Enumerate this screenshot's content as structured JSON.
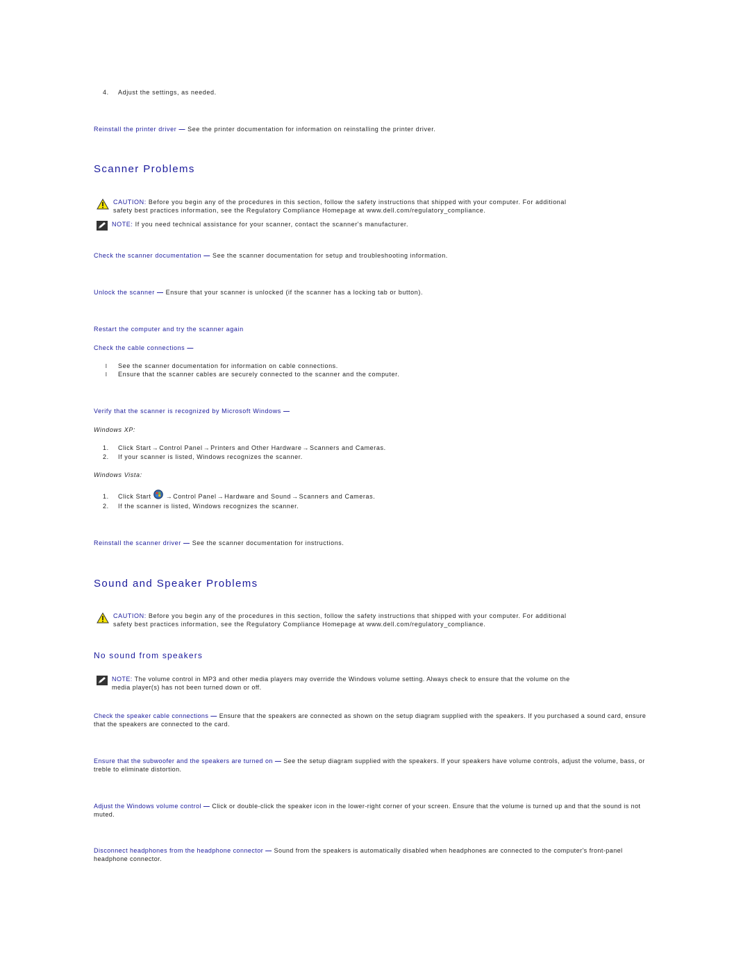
{
  "colors": {
    "link": "#1a1a9c",
    "text": "#222222",
    "caution_yellow": "#f5e400"
  },
  "top": {
    "step4_num": "4.",
    "step4_text": "Adjust the settings, as needed.",
    "reinstall_printer": {
      "link": "Reinstall the printer driver",
      "dash": "—",
      "text": "See the printer documentation for information on reinstalling the printer driver."
    }
  },
  "scanner": {
    "title": "Scanner Problems",
    "caution": {
      "icon": "warning-triangle-icon",
      "label": "CAUTION:",
      "line1": "Before you begin any of the procedures in this section, follow the safety instructions that shipped with your computer. For additional",
      "line2": "safety best practices information, see the Regulatory Compliance Homepage at www.dell.com/regulatory_compliance."
    },
    "note": {
      "icon": "note-pencil-icon",
      "label": "NOTE:",
      "text": "If you need technical assistance for your scanner, contact the scanner's manufacturer."
    },
    "check_docs": {
      "link": "Check the scanner documentation",
      "dash": "—",
      "text": "See the scanner documentation for setup and troubleshooting information."
    },
    "unlock": {
      "link": "Unlock the scanner",
      "dash": "—",
      "text": "Ensure that your scanner is unlocked (if the scanner has a locking tab or button)."
    },
    "restart": {
      "link": "Restart the computer and try the scanner again"
    },
    "cables": {
      "link": "Check the cable connections",
      "dash": "—",
      "bullets": [
        "See the scanner documentation for information on cable connections.",
        "Ensure that the scanner cables are securely connected to the scanner and the computer."
      ],
      "bullet_glyph": "l"
    },
    "verify": {
      "link": "Verify that the scanner is recognized by Microsoft Windows",
      "dash": "—",
      "xp_label": "Windows XP:",
      "xp_steps": [
        {
          "num": "1.",
          "parts": [
            "Click Start",
            "→",
            "Control Panel",
            "→",
            "Printers and Other Hardware",
            "→",
            "Scanners and Cameras."
          ]
        },
        {
          "num": "2.",
          "text": "If your scanner is listed, Windows recognizes the scanner."
        }
      ],
      "vista_label": "Windows Vista:",
      "vista_steps": [
        {
          "num": "1.",
          "parts": [
            "Click Start",
            "→",
            "Control Panel",
            "→",
            "Hardware and Sound",
            "→",
            "Scanners and Cameras."
          ],
          "icon": "windows-start-icon"
        },
        {
          "num": "2.",
          "text": "If the scanner is listed, Windows recognizes the scanner."
        }
      ]
    },
    "reinstall": {
      "link": "Reinstall the scanner driver",
      "dash": "—",
      "text": "See the scanner documentation for instructions."
    }
  },
  "sound": {
    "title": "Sound and Speaker Problems",
    "caution": {
      "icon": "warning-triangle-icon",
      "label": "CAUTION:",
      "line1": "Before you begin any of the procedures in this section, follow the safety instructions that shipped with your computer. For additional",
      "line2": "safety best practices information, see the Regulatory Compliance Homepage at www.dell.com/regulatory_compliance."
    },
    "subtitle": "No sound from speakers",
    "note": {
      "icon": "note-pencil-icon",
      "label": "NOTE:",
      "line1": "The volume control in MP3 and other media players may override the Windows volume setting. Always check to ensure that the volume on the",
      "line2": "media player(s) has not been turned down or off."
    },
    "items": [
      {
        "link": "Check the speaker cable connections",
        "dash": "—",
        "text": "Ensure that the speakers are connected as shown on the setup diagram supplied with the speakers. If you purchased a sound card, ensure that the speakers are connected to the card."
      },
      {
        "link": "Ensure that the subwoofer and the speakers are turned on",
        "dash": "—",
        "text": "See the setup diagram supplied with the speakers. If your speakers have volume controls, adjust the volume, bass, or treble to eliminate distortion."
      },
      {
        "link": "Adjust the Windows volume control",
        "dash": "—",
        "text": "Click or double-click the speaker icon in the lower-right corner of your screen. Ensure that the volume is turned up and that the sound is not muted."
      },
      {
        "link": "Disconnect headphones from the headphone connector",
        "dash": "—",
        "text": "Sound from the speakers is automatically disabled when headphones are connected to the computer's front-panel headphone connector."
      }
    ]
  }
}
